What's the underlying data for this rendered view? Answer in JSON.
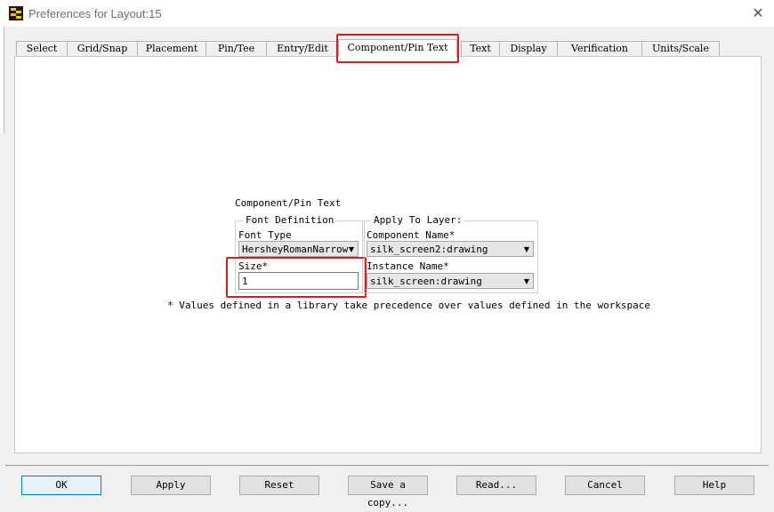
{
  "window": {
    "title": "Preferences for Layout:15",
    "close_glyph": "✕"
  },
  "tabs": [
    {
      "label": "Select"
    },
    {
      "label": "Grid/Snap"
    },
    {
      "label": "Placement"
    },
    {
      "label": "Pin/Tee"
    },
    {
      "label": "Entry/Edit"
    },
    {
      "label": "Component/Pin Text",
      "active": true
    },
    {
      "label": "Text"
    },
    {
      "label": "Display"
    },
    {
      "label": "Verification"
    },
    {
      "label": "Units/Scale"
    }
  ],
  "section": {
    "title": "Component/Pin Text",
    "font_definition": {
      "group_label": "Font Definition",
      "font_type_label": "Font Type",
      "font_type_value": "HersheyRomanNarrow",
      "size_label": "Size*",
      "size_value": "1"
    },
    "apply_to_layer": {
      "group_label": "Apply To Layer:",
      "component_name_label": "Component Name*",
      "component_name_value": "silk_screen2:drawing",
      "instance_name_label": "Instance Name*",
      "instance_name_value": "silk_screen:drawing"
    },
    "note": "* Values defined in a library take precedence over values defined in the workspace"
  },
  "buttons": {
    "ok": "OK",
    "apply": "Apply",
    "reset": "Reset",
    "save_copy": "Save a copy...",
    "read": "Read...",
    "cancel": "Cancel",
    "help": "Help"
  },
  "colors": {
    "highlight": "#e31b1b",
    "default_button_border": "#0078d7"
  },
  "icons": {
    "dropdown": "▼"
  }
}
